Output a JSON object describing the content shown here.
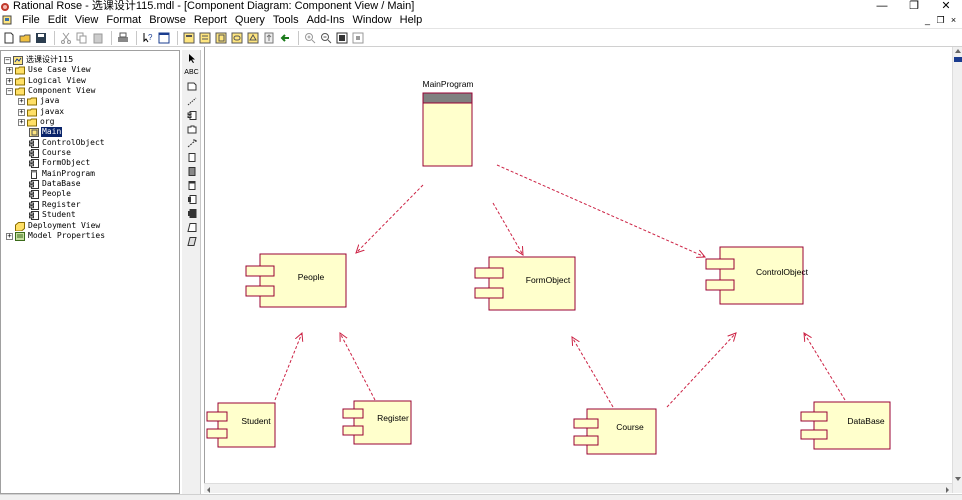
{
  "window": {
    "title": "Rational Rose - 选课设计115.mdl - [Component Diagram: Component View / Main]",
    "controls": {
      "minimize": "—",
      "restore": "❐",
      "close": "✕"
    }
  },
  "menu": {
    "items": [
      "File",
      "Edit",
      "View",
      "Format",
      "Browse",
      "Report",
      "Query",
      "Tools",
      "Add-Ins",
      "Window",
      "Help"
    ],
    "mdi_controls": {
      "minimize": "_",
      "restore": "❐",
      "close": "×"
    }
  },
  "browser": {
    "root": "选课设计115",
    "use_case_view": "Use Case View",
    "logical_view": "Logical View",
    "component_view": "Component View",
    "packages": [
      "java",
      "javax",
      "org"
    ],
    "component_items": [
      "Main",
      "ControlObject",
      "Course",
      "FormObject",
      "MainProgram",
      "DataBase",
      "People",
      "Register",
      "Student"
    ],
    "selected": "Main",
    "deployment_view": "Deployment View",
    "model_properties": "Model Properties"
  },
  "palette": {
    "text_tool": "ABC"
  },
  "diagram": {
    "main_program": {
      "name": "MainProgram"
    },
    "components": {
      "people": "People",
      "form_object": "FormObject",
      "control_object": "ControlObject",
      "student": "Student",
      "register": "Register",
      "course": "Course",
      "database": "DataBase"
    },
    "colors": {
      "fill": "#ffffcc",
      "stroke": "#990033",
      "header": "#808080",
      "arrow": "#cc2244"
    }
  }
}
